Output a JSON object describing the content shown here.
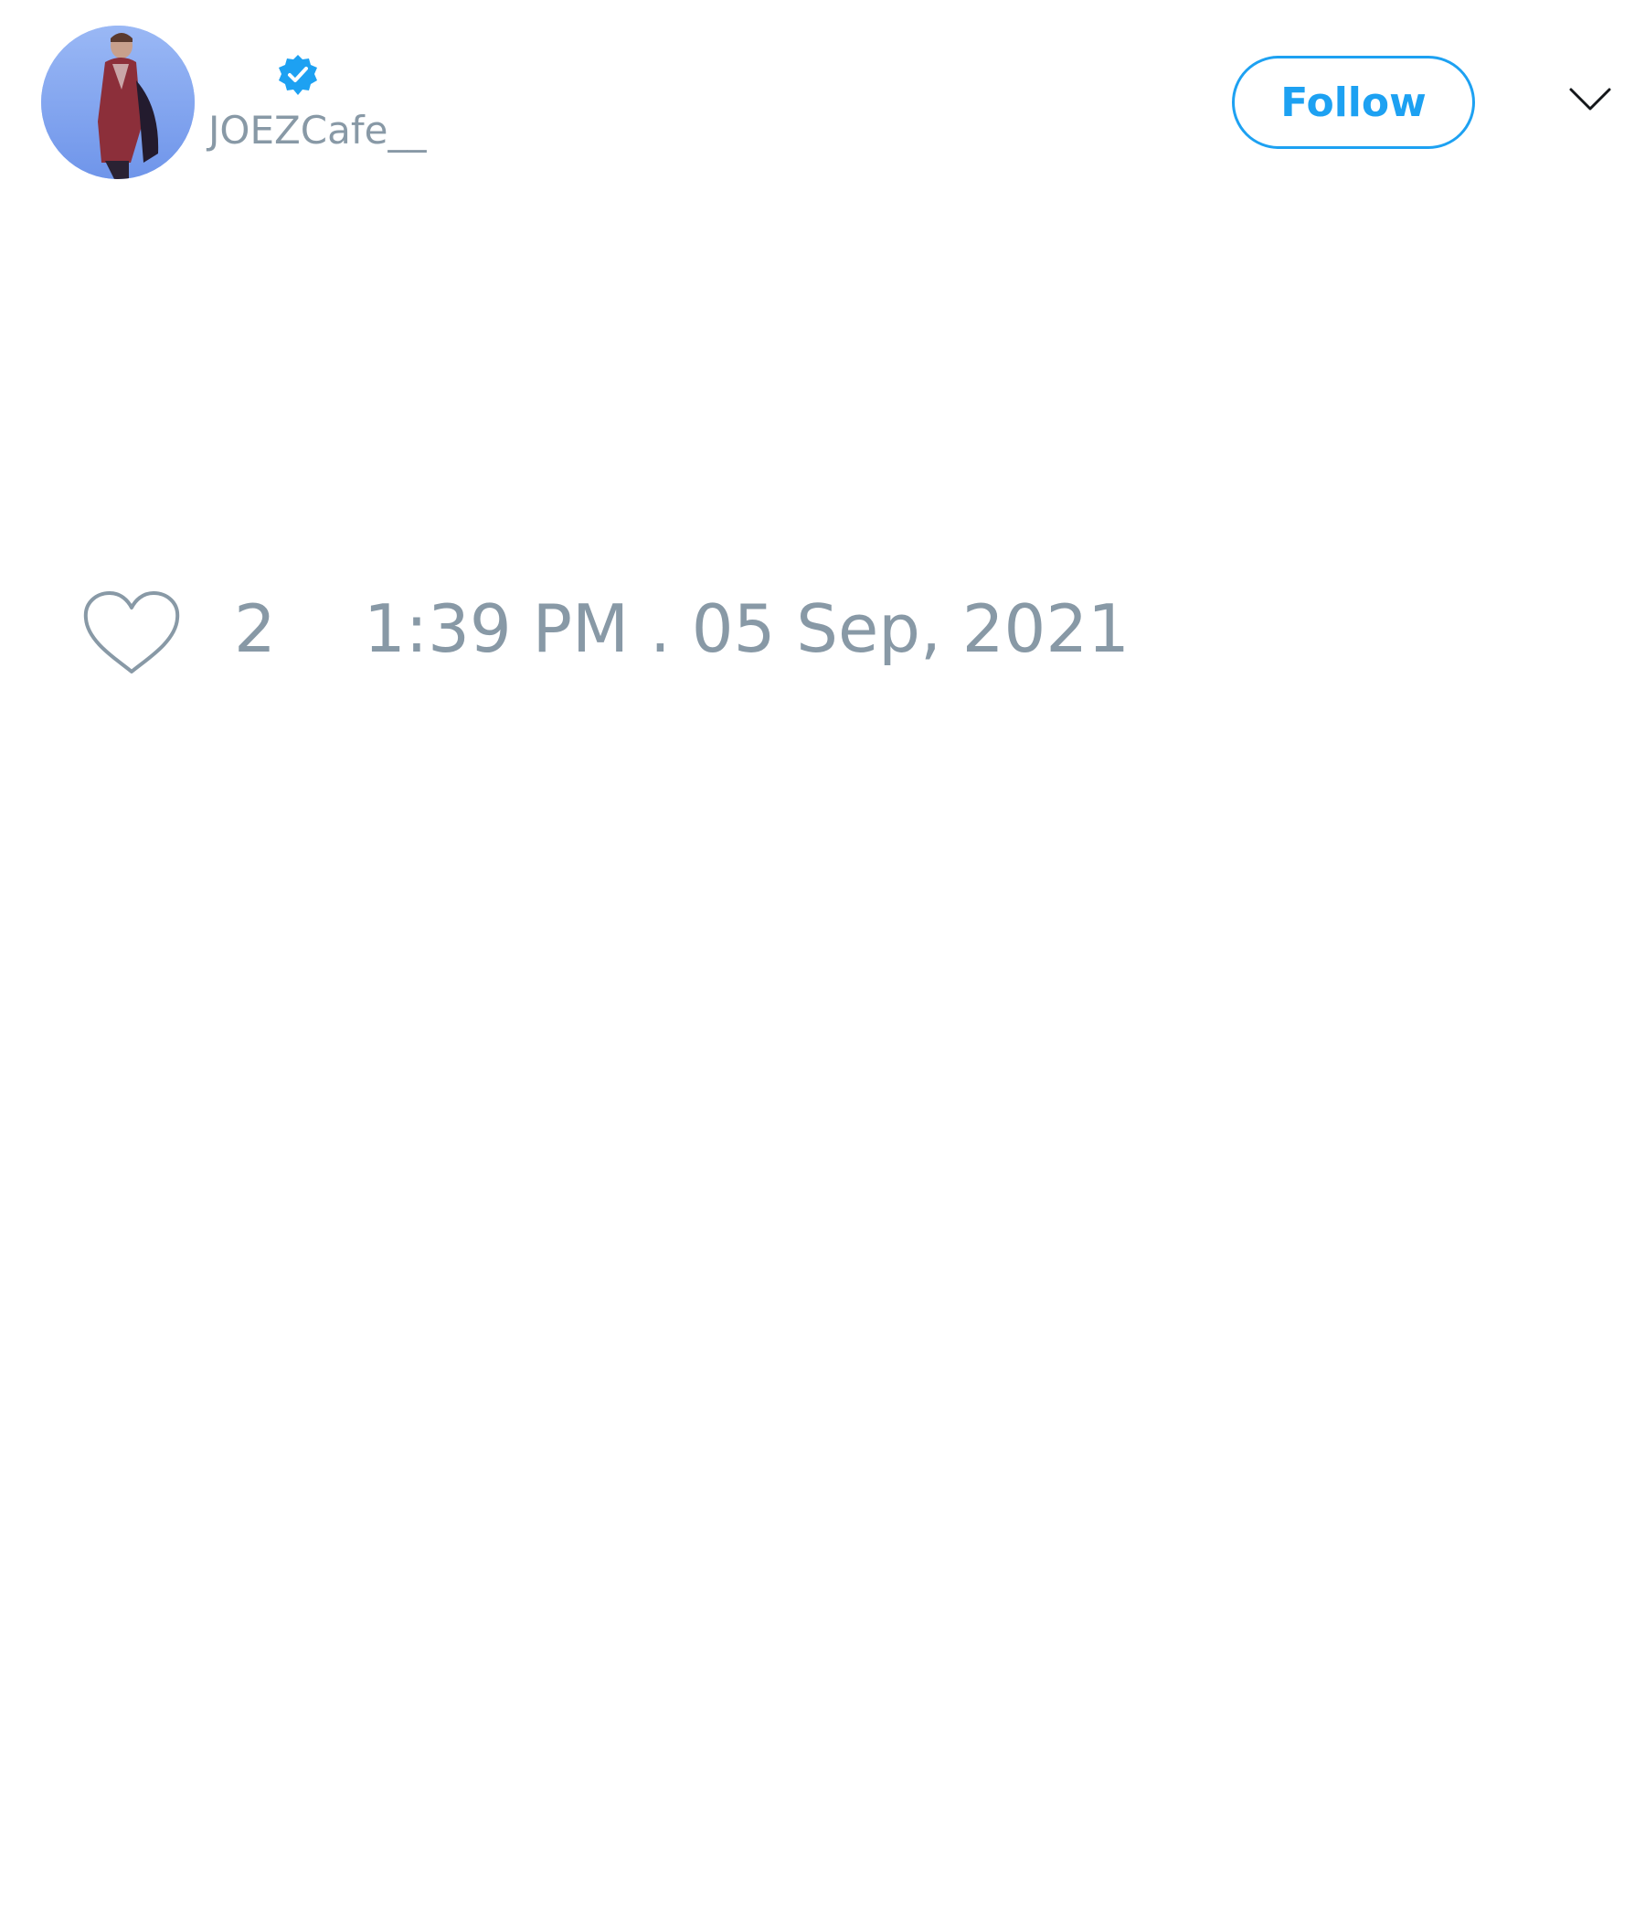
{
  "author": {
    "handle": "JOEZCafe__",
    "verified": true,
    "avatar_icon": "profile-photo"
  },
  "header": {
    "follow_label": "Follow",
    "menu_icon": "chevron-down-icon"
  },
  "engagement": {
    "like_icon": "heart-icon",
    "like_count": "2",
    "timestamp": "1:39 PM . 05 Sep, 2021"
  },
  "colors": {
    "accent": "#1da1f2",
    "muted_text": "#8899a6",
    "background": "#ffffff"
  }
}
